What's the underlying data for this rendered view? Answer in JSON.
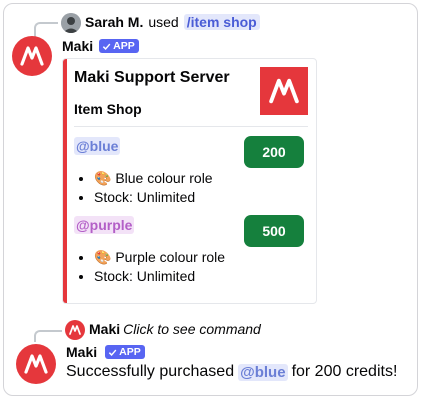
{
  "first_interaction": {
    "user_name": "Sarah M.",
    "used_text": "used",
    "command": "/item shop"
  },
  "first_message": {
    "author": "Maki",
    "badge": "APP",
    "embed": {
      "title": "Maki Support Server",
      "subtitle": "Item Shop",
      "accent_color": "#e5373c",
      "items": [
        {
          "role": "@blue",
          "price": "200",
          "lines": [
            "🎨 Blue colour role",
            "Stock: Unlimited"
          ]
        },
        {
          "role": "@purple",
          "price": "500",
          "lines": [
            "🎨 Purple colour role",
            "Stock: Unlimited"
          ]
        }
      ]
    }
  },
  "second_interaction": {
    "author": "Maki",
    "hint": "Click to see command"
  },
  "second_message": {
    "author": "Maki",
    "badge": "APP",
    "text_before": "Successfully purchased",
    "mention": "@blue",
    "text_after": "for 200 credits!"
  },
  "colors": {
    "brand": "#e5373c",
    "app_badge": "#5865f2",
    "price_button": "#15803d"
  }
}
